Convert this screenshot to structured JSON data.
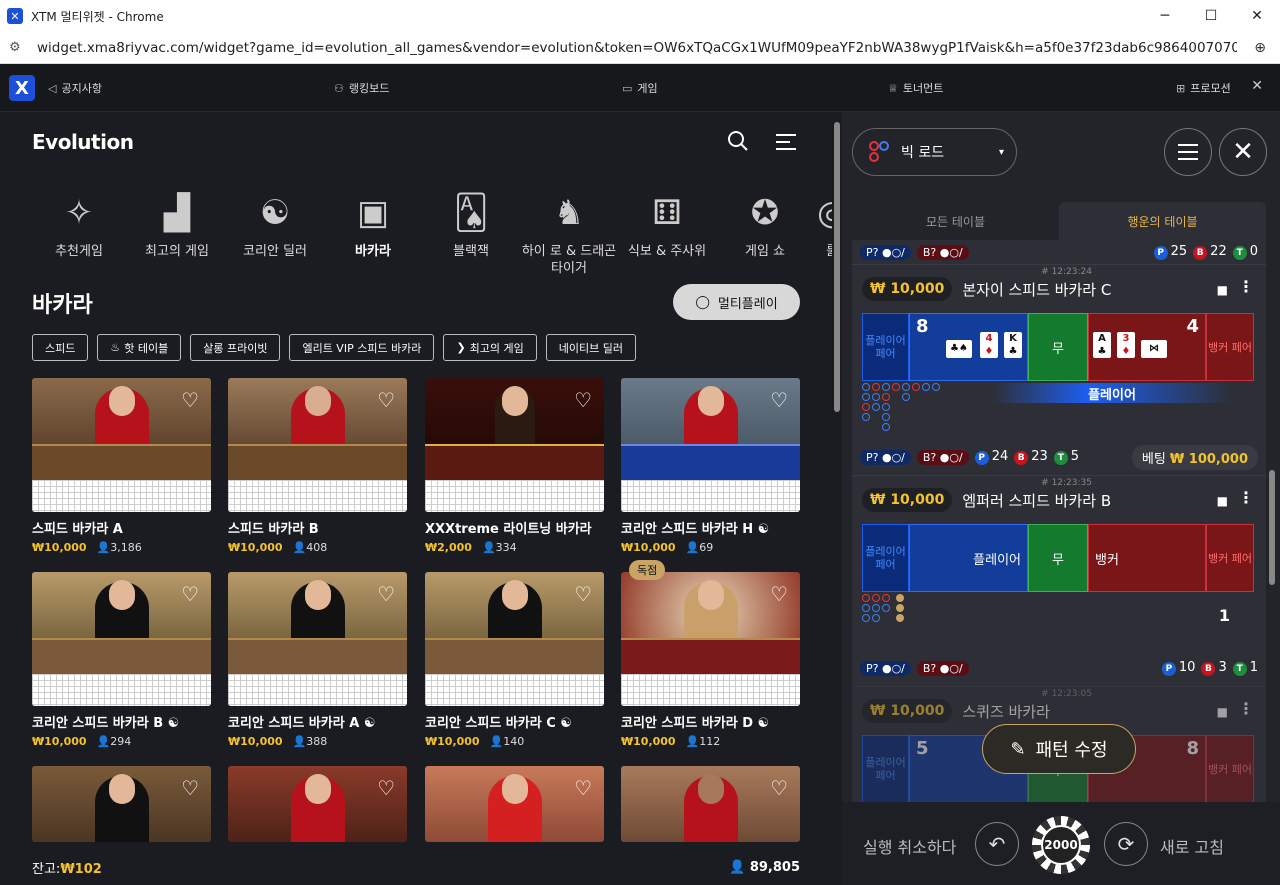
{
  "window": {
    "title": "XTM 멀티위젯 - Chrome",
    "url": "widget.xma8riyvac.com/widget?game_id=evolution_all_games&vendor=evolution&token=OW6xTQaCGx1WUfM09peaYF2nbWA38wygP1fVaisk&h=a5f0e37f23dab6c986400707018730f0&_"
  },
  "topnav": {
    "notice": "공지사항",
    "ranking": "랭킹보드",
    "games": "게임",
    "tournament": "토너먼트",
    "promo": "프로모션"
  },
  "vendor": {
    "logo": "Evolution"
  },
  "categories": [
    {
      "label": "추천게임"
    },
    {
      "label": "최고의 게임"
    },
    {
      "label": "코리안 딜러"
    },
    {
      "label": "바카라"
    },
    {
      "label": "블랙잭"
    },
    {
      "label": "하이 로 & 드래곤타이거"
    },
    {
      "label": "식보 & 주사위"
    },
    {
      "label": "게임 쇼"
    },
    {
      "label": "룰"
    }
  ],
  "section": {
    "title": "바카라",
    "multiplay": "멀티플레이"
  },
  "filters": [
    "스피드",
    "핫 테이블",
    "살롱 프라이빗",
    "엘리트 VIP 스피드 바카라",
    "최고의 게임",
    "네이티브 딜러"
  ],
  "games": [
    {
      "name": "스피드 바카라 A",
      "bet": "₩10,000",
      "players": "3,186"
    },
    {
      "name": "스피드 바카라 B",
      "bet": "₩10,000",
      "players": "408"
    },
    {
      "name": "XXXtreme 라이트닝 바카라",
      "bet": "₩2,000",
      "players": "334"
    },
    {
      "name": "코리안 스피드 바카라 H",
      "bet": "₩10,000",
      "players": "69"
    },
    {
      "name": "코리안 스피드 바카라 B",
      "bet": "₩10,000",
      "players": "294"
    },
    {
      "name": "코리안 스피드 바카라 A",
      "bet": "₩10,000",
      "players": "388"
    },
    {
      "name": "코리안 스피드 바카라 C",
      "bet": "₩10,000",
      "players": "140"
    },
    {
      "name": "코리안 스피드 바카라 D",
      "bet": "₩10,000",
      "players": "112",
      "badge": "독점"
    }
  ],
  "footer": {
    "balance_label": "잔고:",
    "balance": "₩102",
    "total_players": "89,805"
  },
  "rightpanel": {
    "road_select": "빅 로드",
    "tabs": [
      "모든 테이블",
      "행운의 테이블"
    ],
    "top_stats": {
      "p": "25",
      "b": "22",
      "t": "0"
    },
    "tables": [
      {
        "time": "# 12:23:24",
        "bet": "₩ 10,000",
        "name": "본자이 스피드 바카라 C",
        "player_score": "8",
        "banker_score": "4",
        "winner": "플레이어",
        "p": "24",
        "b": "23",
        "t": "5",
        "betted_label": "베팅",
        "betted": "₩ 100,000"
      },
      {
        "time": "# 12:23:35",
        "bet": "₩ 10,000",
        "name": "엠퍼러 스피드 바카라 B",
        "player_label": "플레이어",
        "banker_label": "뱅커",
        "count": "1",
        "p": "10",
        "b": "3",
        "t": "1"
      },
      {
        "time": "# 12:23:05",
        "bet": "₩ 10,000",
        "name": "스퀴즈 바카라",
        "player_score": "5",
        "banker_score": "8"
      }
    ],
    "pp": "플레이어 페어",
    "tie": "무",
    "bp": "뱅커 페어",
    "pq": "P?",
    "bq": "B?",
    "edit_pattern": "패턴 수정",
    "undo": "실행 취소하다",
    "chip": "2000",
    "refresh": "새로 고침"
  }
}
